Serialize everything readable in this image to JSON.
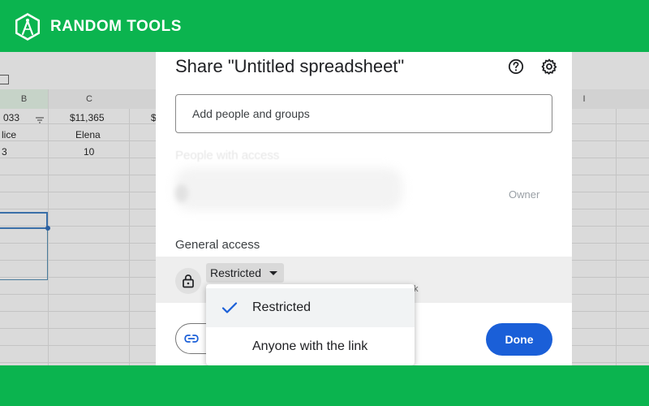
{
  "brand": {
    "name": "RANDOM TOOLS",
    "logo_icon": "compass-hexagon-icon",
    "color": "#0bb44f"
  },
  "spreadsheet": {
    "column_headers": [
      "B",
      "C",
      "I"
    ],
    "rows": [
      [
        "033",
        "$11,365",
        "$"
      ],
      [
        "lice",
        "Elena"
      ],
      [
        "3",
        "10"
      ]
    ]
  },
  "share_dialog": {
    "title": "Share \"Untitled spreadsheet\"",
    "icons": [
      "help-icon",
      "settings-icon"
    ],
    "add_people_placeholder": "Add people and groups",
    "people_with_access_heading": "People with access",
    "owner_label": "Owner",
    "general_access_heading": "General access",
    "access_level": "Restricted",
    "access_description_tail": "k",
    "done_label": "Done",
    "accent_color": "#1a5fd8"
  },
  "access_dropdown": {
    "options": [
      {
        "label": "Restricted",
        "selected": true
      },
      {
        "label": "Anyone with the link",
        "selected": false
      }
    ]
  }
}
